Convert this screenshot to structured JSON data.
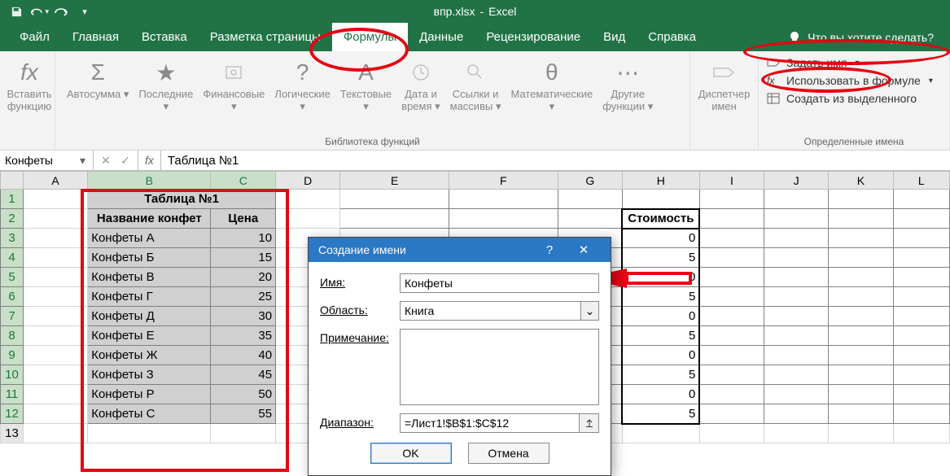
{
  "title": {
    "filename": "впр.xlsx",
    "app": "Excel"
  },
  "qat": {
    "save": "save-icon",
    "undo": "undo-icon",
    "redo": "redo-icon",
    "customize": "customize-icon"
  },
  "tabs": {
    "file": "Файл",
    "home": "Главная",
    "insert": "Вставка",
    "pagelayout": "Разметка страницы",
    "formulas": "Формулы",
    "data": "Данные",
    "review": "Рецензирование",
    "view": "Вид",
    "help": "Справка",
    "tellme": "Что вы хотите сделать?"
  },
  "ribbon": {
    "insert_fn_1": "Вставить",
    "insert_fn_2": "функцию",
    "autosum": "Автосумма",
    "recent": "Последние",
    "financial": "Финансовые",
    "logical": "Логические",
    "text": "Текстовые",
    "datetime_1": "Дата и",
    "datetime_2": "время",
    "lookup_1": "Ссылки и",
    "lookup_2": "массивы",
    "math": "Математические",
    "more_1": "Другие",
    "more_2": "функции",
    "lib_label": "Библиотека функций",
    "name_mgr_1": "Диспетчер",
    "name_mgr_2": "имен",
    "define_name": "Задать имя",
    "use_in_formula": "Использовать в формуле",
    "create_from_sel": "Создать из выделенного",
    "defined_names_label": "Определенные имена"
  },
  "formula_bar": {
    "name_box": "Конфеты",
    "formula": "Таблица №1"
  },
  "columns": [
    "A",
    "B",
    "C",
    "D",
    "E",
    "F",
    "G",
    "H",
    "I",
    "J",
    "K",
    "L"
  ],
  "rows": [
    "1",
    "2",
    "3",
    "4",
    "5",
    "6",
    "7",
    "8",
    "9",
    "10",
    "11",
    "12",
    "13"
  ],
  "table1": {
    "title": "Таблица №1",
    "hdr_name": "Название конфет",
    "hdr_price": "Цена",
    "rows": [
      {
        "name": "Конфеты А",
        "price": "10"
      },
      {
        "name": "Конфеты Б",
        "price": "15"
      },
      {
        "name": "Конфеты В",
        "price": "20"
      },
      {
        "name": "Конфеты Г",
        "price": "25"
      },
      {
        "name": "Конфеты Д",
        "price": "30"
      },
      {
        "name": "Конфеты Е",
        "price": "35"
      },
      {
        "name": "Конфеты Ж",
        "price": "40"
      },
      {
        "name": "Конфеты З",
        "price": "45"
      },
      {
        "name": "Конфеты Р",
        "price": "50"
      },
      {
        "name": "Конфеты С",
        "price": "55"
      }
    ]
  },
  "stoim": {
    "header": "Стоимость",
    "vals": [
      "0",
      "5",
      "0",
      "5",
      "0",
      "5",
      "0",
      "5",
      "0",
      "5"
    ]
  },
  "dialog": {
    "title": "Создание имени",
    "lbl_name": "Имя:",
    "name_val": "Конфеты",
    "lbl_scope": "Область:",
    "scope_val": "Книга",
    "lbl_comment": "Примечание:",
    "comment_val": "",
    "lbl_range": "Диапазон:",
    "range_val": "=Лист1!$B$1:$C$12",
    "ok": "OK",
    "cancel": "Отмена"
  }
}
